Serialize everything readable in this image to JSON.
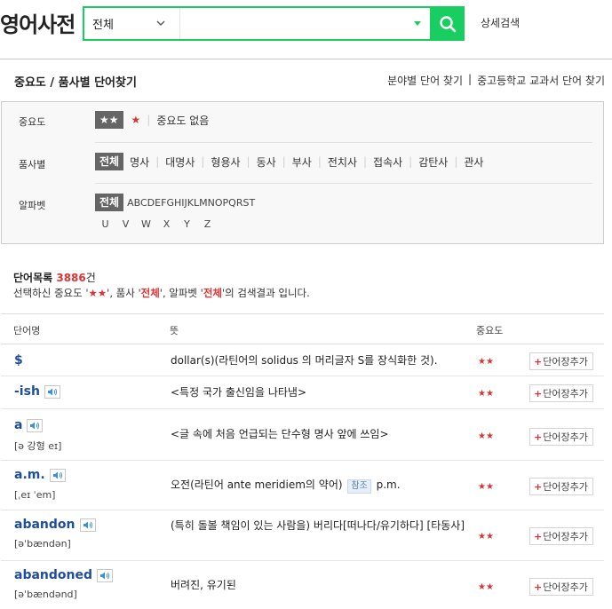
{
  "logo": "영어사전",
  "search": {
    "scope": "전체",
    "value": "",
    "advanced": "상세검색"
  },
  "section": {
    "title": "중요도 / 품사별 단어찾기",
    "link_field": "분야별 단어 찾기",
    "link_school": "중고등학교 교과서 단어 찾기"
  },
  "filters": {
    "importance": {
      "label": "중요도",
      "selected": "★★",
      "one_star": "★",
      "none": "중요도 없음"
    },
    "pos": {
      "label": "품사별",
      "selected": "전체",
      "options": [
        "명사",
        "대명사",
        "형용사",
        "동사",
        "부사",
        "전치사",
        "접속사",
        "감탄사",
        "관사"
      ]
    },
    "alphabet": {
      "label": "알파벳",
      "selected": "전체",
      "row1": [
        "A",
        "B",
        "C",
        "D",
        "E",
        "F",
        "G",
        "H",
        "I",
        "J",
        "K",
        "L",
        "M",
        "N",
        "O",
        "P",
        "Q",
        "R",
        "S",
        "T"
      ],
      "row2": [
        "U",
        "V",
        "W",
        "X",
        "Y",
        "Z"
      ]
    }
  },
  "results": {
    "title": "단어목록",
    "count": "3886",
    "count_unit": "건",
    "desc_1": "선택하신 중요도 '",
    "desc_importance": "★★",
    "desc_2": "', 품사 '",
    "desc_pos": "전체",
    "desc_3": "', 알파벳 '",
    "desc_alpha": "전체",
    "desc_4": "'의 검색결과 입니다."
  },
  "table": {
    "col_word": "단어명",
    "col_meaning": "뜻",
    "col_importance": "중요도",
    "add_label": "단어장추가",
    "ref_label": "참조",
    "rows": [
      {
        "word": "$",
        "pron": "",
        "meaning": "dollar(s)(라틴어의 solidus 의 머리글자 S를 장식화한 것).",
        "importance": "★★"
      },
      {
        "word": "-ish",
        "pron": "",
        "meaning": "<특정 국가 출신임을 나타냄>",
        "importance": "★★"
      },
      {
        "word": "a",
        "pron": "[ə 강형 eɪ]",
        "meaning": "<글 속에 처음 언급되는 단수형 명사 앞에 쓰임>",
        "importance": "★★"
      },
      {
        "word": "a.m.",
        "pron": "[ˌeɪ ˈem]",
        "meaning": "오전(라틴어 ante meridiem의 약어)",
        "meaning_after": "p.m.",
        "importance": "★★"
      },
      {
        "word": "abandon",
        "pron": "[əˈbændən]",
        "meaning": "(특히 돌볼 책임이 있는 사람을) 버리다[떠나다/유기하다] [타동사]",
        "importance": "★★"
      },
      {
        "word": "abandoned",
        "pron": "[əˈbændənd]",
        "meaning": "버려진, 유기된",
        "importance": "★★"
      }
    ]
  },
  "colors": {
    "brand": "#19ce60",
    "accent_red": "#dd3333",
    "link_blue": "#1f4e9e"
  }
}
